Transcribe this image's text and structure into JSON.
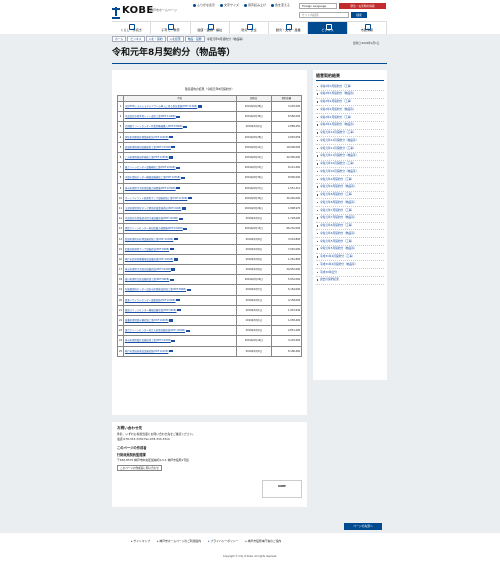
{
  "header": {
    "logo": "KOBE",
    "logo_sub": "神戸市ホームページ",
    "utility": [
      "ふりがな表示",
      "文字サイズ",
      "音声読み上げ",
      "色を変える"
    ],
    "language": "Foreign Language",
    "emergency": "緊急・災害時の情報",
    "search_placeholder": "サイト内検索",
    "search_button": "検索",
    "nav": [
      "くらし・手続き",
      "子育て・教育",
      "健康・医療・福祉",
      "防災・安全",
      "観光・文化・産業",
      "ビジネス",
      "市政情報"
    ],
    "nav_active_index": 5
  },
  "breadcrumb": [
    "ホーム",
    "ビジネス",
    "入札・契約",
    "入札結果",
    "物品・役務",
    "令和元年8月契約分（物品等）"
  ],
  "updated": "更新日:2020年4月1日",
  "page_title": "令和元年8月契約分（物品等）",
  "table": {
    "caption": "随意契約の結果（令和元年8月契約分）",
    "headers": [
      "",
      "件名",
      "契約日",
      "契約金額"
    ],
    "rows": [
      {
        "no": "1",
        "name": "市民PHRシステムモデルアプリの導入に係る委託業務(PDF:113KB)",
        "date": "2019年8月28日",
        "price": "3,003,500"
      },
      {
        "no": "2",
        "name": "中央卸売市場本場トイレ改修工事(PDF:110KB)",
        "date": "2019年8月30日",
        "price": "8,580,000"
      },
      {
        "no": "3",
        "name": "北須磨クリーンセンター作業用機器購入(PDF:108KB)",
        "date": "2019年8月2日",
        "price": "2,889,250"
      },
      {
        "no": "4",
        "name": "消防車両関係修理業務委託(PDF:104KB)",
        "date": "2019年8月28日",
        "price": "4,893,056"
      },
      {
        "no": "5",
        "name": "西部処理場焼却設備更新工事(PDF:151KB)",
        "date": "2019年8月21日",
        "price": "19,008,000"
      },
      {
        "no": "6",
        "name": "ごみ処理用焼却炉補修工事(PDF:125KB)",
        "date": "2019年8月21日",
        "price": "42,900,000"
      },
      {
        "no": "7",
        "name": "東クリーンセンター設備補修工事(PDF:103KB)",
        "date": "2019年8月23日",
        "price": "8,212,400"
      },
      {
        "no": "8",
        "name": "中部水環境センター機械設備補修工事(PDF:103KB)",
        "date": "2019年8月30日",
        "price": "8,800,000"
      },
      {
        "no": "9",
        "name": "垂水処理場汚泥処理設備点検整備(PDF:105KB)",
        "date": "2019年8月27日",
        "price": "1,551,312"
      },
      {
        "no": "10",
        "name": "ポートアイランド処理場ポンプ設備修繕工事(PDF:121KB)",
        "date": "2019年8月30日",
        "price": "30,240,000"
      },
      {
        "no": "11",
        "name": "玉津処理場消化タンク関係修繕業務委託(PDF:91KB)",
        "date": "2019年8月29日",
        "price": "1,898,970"
      },
      {
        "no": "12",
        "name": "中央卸売市場東部市場冷凍設備修繕(PDF:120KB)",
        "date": "2019年8月2日",
        "price": "1,728,000"
      },
      {
        "no": "13",
        "name": "港島クリーンセンター焼却設備点検整備(PDF:100KB)",
        "date": "2019年8月13日",
        "price": "96,232,000"
      },
      {
        "no": "14",
        "name": "西部処理場水処理設備修繕工事(PDF:103KB)",
        "date": "2019年8月9日",
        "price": "3,034,800"
      },
      {
        "no": "15",
        "name": "鈴蘭台処理場ポンプ設備修繕(PDF:99KB)",
        "date": "2019年8月9日",
        "price": "7,020,000"
      },
      {
        "no": "16",
        "name": "神戸市民病院機構施設設備修繕(PDF:100KB)",
        "date": "2019年8月9日",
        "price": "1,252,800"
      },
      {
        "no": "17",
        "name": "垂水処理場汚泥焼却設備修繕(PDF:102KB)",
        "date": "2019年8月9日",
        "price": "20,952,000"
      },
      {
        "no": "18",
        "name": "湊川処理場計装設備修繕工事(PDF:99KB)",
        "date": "2019年8月29日",
        "price": "5,832,000"
      },
      {
        "no": "19",
        "name": "布施畑環境センター浸出水処理施設修繕工事(PDF:98KB)",
        "date": "2019年8月7日",
        "price": "5,164,000"
      },
      {
        "no": "20",
        "name": "資源リサイクルセンター設備修繕(PDF:100KB)",
        "date": "2019年8月1日",
        "price": "4,158,000"
      },
      {
        "no": "21",
        "name": "東部スラッジセンター機械設備修繕(PDF:99KB)",
        "date": "2019年8月1日",
        "price": "1,907,640"
      },
      {
        "no": "22",
        "name": "東灘処理場脱水機修繕工事(PDF:100KB)",
        "date": "2019年8月1日",
        "price": "1,058,400"
      },
      {
        "no": "23",
        "name": "落合クリーンセンター排ガス処理設備修繕(PDF:105KB)",
        "date": "2019年8月2日",
        "price": "2,851,200"
      },
      {
        "no": "24",
        "name": "垂水処理場電気設備修繕工事(PDF:100KB)",
        "date": "2019年8月16日",
        "price": "3,218,400"
      },
      {
        "no": "25",
        "name": "神戸市環境局施設設備修繕(PDF:101KB)",
        "date": "2019年8月2日",
        "price": "8,186,400"
      }
    ]
  },
  "inquiry": {
    "heading": "お問い合わせ先",
    "text": "件名、いずれも各担当課にお問い合わせ先をご確認ください。",
    "phone": "電話:078-333-3330  Fax:078-333-3314",
    "creator_heading": "このページの作成者",
    "org": "行財政局契約監理課",
    "address": "〒650-8570 神戸市中央区加納町6-5-1 神戸市役所1号館",
    "mail": "このページの作成者に問い合わせ",
    "badge": "KOBE"
  },
  "sidebar": {
    "heading": "随意契約結果",
    "items": [
      "令和2年3月契約分（工事）",
      "令和2年3月契約分（物品等）",
      "令和2年2月契約分（工事）",
      "令和2年2月契約分（物品等）",
      "令和2年1月契約分（工事）",
      "令和2年1月契約分（物品等）",
      "令和元年12月契約分（工事）",
      "令和元年12月契約分（物品等）",
      "令和元年11月契約分（工事）",
      "令和元年11月契約分（物品等）",
      "令和元年10月契約分（工事）",
      "令和元年10月契約分（物品等）",
      "令和元年9月契約分（工事）",
      "令和元年9月契約分（物品等）",
      "令和元年8月契約分（工事）",
      "令和元年8月契約分（物品等）",
      "令和元年7月契約分（工事）",
      "令和元年7月契約分（物品等）",
      "令和元年6月契約分（工事）",
      "令和元年6月契約分（物品等）",
      "令和元年5月契約分（工事）",
      "令和元年5月契約分（物品等）",
      "平成31年4月契約分（工事）",
      "平成31年4月契約分（物品等）",
      "平成30年度分",
      "過去の契約結果"
    ]
  },
  "pagetop": "ページの先頭へ",
  "footer": {
    "links": [
      "サイトマップ",
      "神戸市ホームページのご利用案内",
      "プライバシーポリシー",
      "神戸市役所本庁舎のご案内"
    ],
    "copyright": "Copyright © City of Kobe. All rights reserved."
  }
}
